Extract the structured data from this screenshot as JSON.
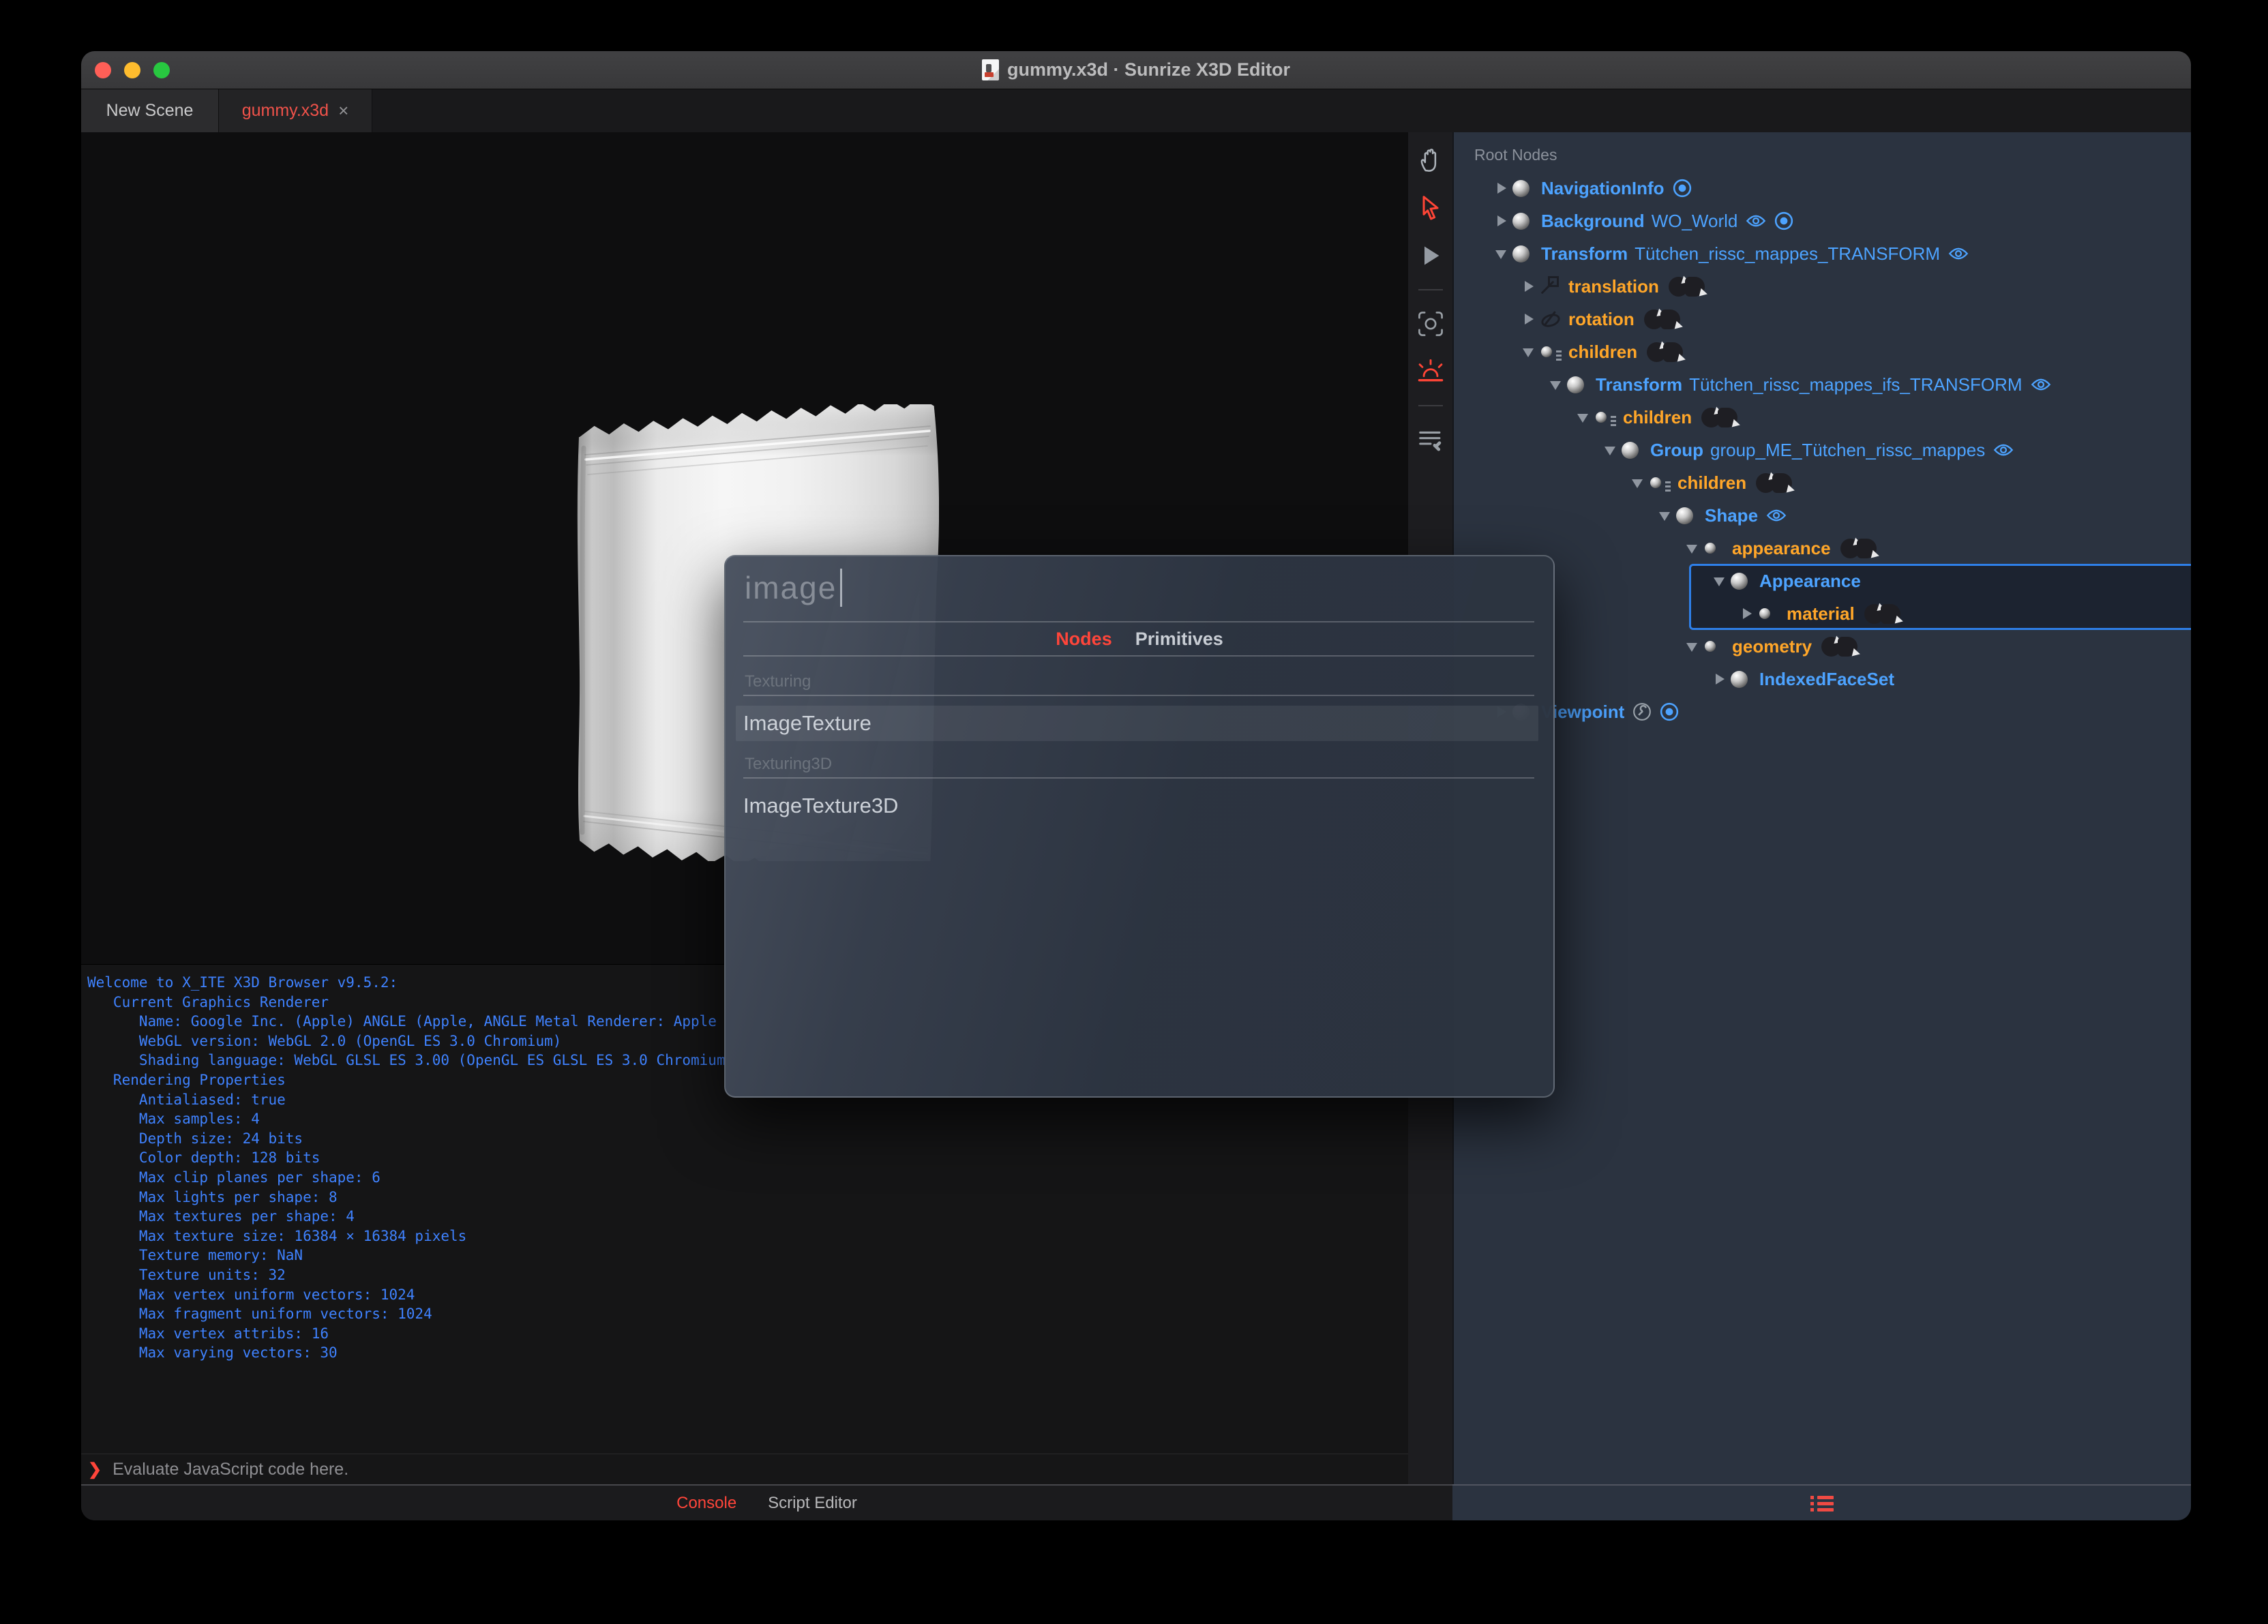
{
  "titlebar": {
    "title": "gummy.x3d · Sunrize X3D Editor"
  },
  "tabs": {
    "items": [
      {
        "label": "New Scene",
        "active": false
      },
      {
        "label": "gummy.x3d",
        "active": true,
        "close_glyph": "×"
      }
    ]
  },
  "viewport_toolbar": {
    "tools": [
      "hand-pan-icon",
      "select-arrow-icon",
      "play-icon",
      "camera-frame-icon",
      "sunrise-light-icon",
      "script-edit-icon"
    ],
    "active_tools": [
      "select-arrow-icon",
      "sunrise-light-icon"
    ]
  },
  "console": {
    "lines": [
      "Welcome to X_ITE X3D Browser v9.5.2:",
      "   Current Graphics Renderer",
      "      Name: Google Inc. (Apple) ANGLE (Apple, ANGLE Metal Renderer: Apple",
      "      WebGL version: WebGL 2.0 (OpenGL ES 3.0 Chromium)",
      "      Shading language: WebGL GLSL ES 3.00 (OpenGL ES GLSL ES 3.0 Chromium",
      "   Rendering Properties",
      "      Antialiased: true",
      "      Max samples: 4",
      "      Depth size: 24 bits",
      "      Color depth: 128 bits",
      "      Max clip planes per shape: 6",
      "      Max lights per shape: 8",
      "      Max textures per shape: 4",
      "      Max texture size: 16384 × 16384 pixels",
      "      Texture memory: NaN",
      "      Texture units: 32",
      "      Max vertex uniform vectors: 1024",
      "      Max fragment uniform vectors: 1024",
      "      Max vertex attribs: 16",
      "      Max varying vectors: 30"
    ],
    "prompt_glyph": "❯",
    "prompt_placeholder": "Evaluate JavaScript code here."
  },
  "status_bar": {
    "tabs": [
      {
        "label": "Console",
        "active": true
      },
      {
        "label": "Script Editor",
        "active": false
      }
    ]
  },
  "outline_editor": {
    "header": "Root Nodes",
    "rows": [
      {
        "indent": 0,
        "arrow": "closed",
        "icon": "node",
        "kind": "node",
        "label": "NavigationInfo",
        "bind": true
      },
      {
        "indent": 0,
        "arrow": "closed",
        "icon": "node",
        "kind": "node",
        "label": "Background",
        "name": "WO_World",
        "eye": true,
        "bind": true
      },
      {
        "indent": 0,
        "arrow": "open",
        "icon": "node",
        "kind": "node",
        "label": "Transform",
        "name": "Tütchen_rissc_mappes_TRANSFORM",
        "eye": true
      },
      {
        "indent": 1,
        "arrow": "closed",
        "icon": "translation",
        "kind": "field",
        "label": "translation",
        "routes": true
      },
      {
        "indent": 1,
        "arrow": "closed",
        "icon": "rotation",
        "kind": "field",
        "label": "rotation",
        "routes": true
      },
      {
        "indent": 1,
        "arrow": "open",
        "icon": "children",
        "kind": "field",
        "label": "children",
        "routes": true
      },
      {
        "indent": 2,
        "arrow": "open",
        "icon": "node",
        "kind": "node",
        "label": "Transform",
        "name": "Tütchen_rissc_mappes_ifs_TRANSFORM",
        "eye": true
      },
      {
        "indent": 3,
        "arrow": "open",
        "icon": "children",
        "kind": "field",
        "label": "children",
        "routes": true
      },
      {
        "indent": 4,
        "arrow": "open",
        "icon": "node",
        "kind": "node",
        "label": "Group",
        "name": "group_ME_Tütchen_rissc_mappes",
        "eye": true
      },
      {
        "indent": 5,
        "arrow": "open",
        "icon": "children",
        "kind": "field",
        "label": "children",
        "routes": true
      },
      {
        "indent": 6,
        "arrow": "open",
        "icon": "node",
        "kind": "node",
        "label": "Shape",
        "eye": true
      },
      {
        "indent": 7,
        "arrow": "open",
        "icon": "field",
        "kind": "field",
        "label": "appearance",
        "routes": true
      },
      {
        "indent": 8,
        "arrow": "open",
        "icon": "node",
        "kind": "node",
        "label": "Appearance",
        "selected": true
      },
      {
        "indent": 9,
        "arrow": "closed",
        "icon": "field",
        "kind": "field",
        "label": "material",
        "routes": true,
        "selected": true
      },
      {
        "indent": 7,
        "arrow": "open",
        "icon": "field",
        "kind": "field",
        "label": "geometry",
        "routes": true
      },
      {
        "indent": 8,
        "arrow": "closed",
        "icon": "node",
        "kind": "node",
        "label": "IndexedFaceSet"
      },
      {
        "indent": 0,
        "arrow": "closed",
        "icon": "node",
        "kind": "node",
        "label": "Viewpoint",
        "wrench": true,
        "bind": true
      }
    ]
  },
  "node_dialog": {
    "search_value": "image",
    "tabs": [
      {
        "label": "Nodes",
        "active": true
      },
      {
        "label": "Primitives",
        "active": false
      }
    ],
    "sections": [
      {
        "label": "Texturing",
        "items": [
          {
            "label": "ImageTexture",
            "highlighted": true
          }
        ]
      },
      {
        "label": "Texturing3D",
        "items": [
          {
            "label": "ImageTexture3D",
            "highlighted": false
          }
        ]
      }
    ]
  },
  "colors": {
    "accent_red": "#ff453a",
    "node_blue": "#4da3ff",
    "field_orange": "#ffa629",
    "console_blue": "#3f82ff",
    "panel_bg": "#2b3340",
    "selection_border": "#2e7fe8"
  }
}
